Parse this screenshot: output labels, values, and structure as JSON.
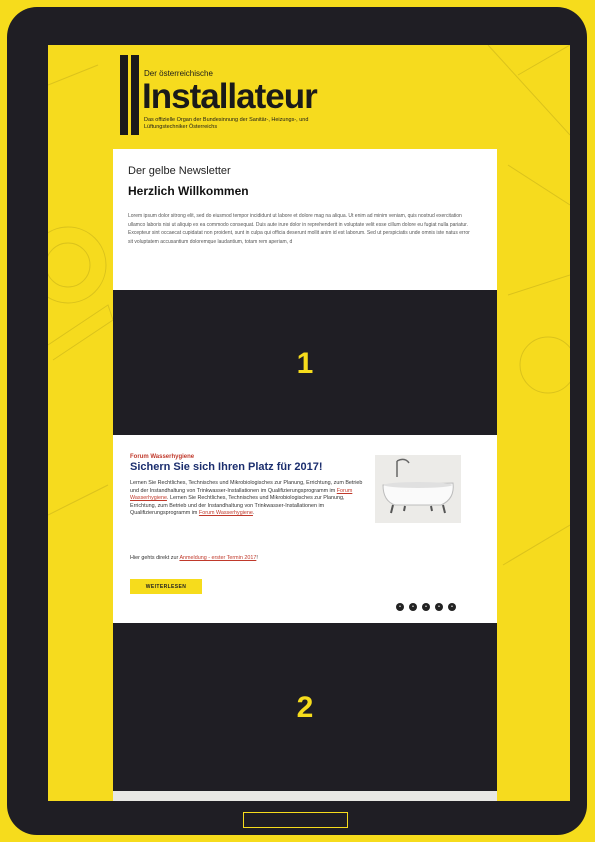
{
  "brand": {
    "kicker": "Der österreichische",
    "name": "Installateur",
    "tagline": "Das offizielle Organ der Bundesinnung der Sanitär-, Heizungs-, und Lüftungstechniker Österreichs"
  },
  "intro": {
    "newsletter_title": "Der gelbe Newsletter",
    "welcome": "Herzlich Willkommen",
    "lorem": "Lorem ipsum dolor sitrong elit, sed do eiusmod tempor incididunt ut labore et dolore mag na aliqua. Ut enim ad minim veniam, quis nostrud exercitation ullamco laboris nisi ut aliquip ex ea commodo consequat. Duis aute irure dolor in reprehenderit in voluptate velit esse cillum dolore eu fugiat nulla pariatur. Excepteur sint occaecat cupidatat non proident, sunt in culpa qui officia deserunt mollit anim id est laborum. Sed ut perspiciatis unde omnis iste natus error sit voluptatem accusantium doloremque laudantium, totam rem aperiam, d"
  },
  "placeholders": {
    "first": "1",
    "second": "2"
  },
  "article": {
    "kicker": "Forum Wasserhygiene",
    "headline": "Sichern Sie sich Ihren Platz für 2017!",
    "body_part1": "Lernen Sie Rechtliches, Technisches und Mikrobiologisches zur Planung, Errichtung, zum Betrieb und der Instandhaltung von Trinkwasser-Installationen im Qualifizierungsprogramm im ",
    "link1": "Forum Wasserhygiene",
    "body_part2": ". Lernen Sie Rechtliches, Technisches und Mikrobiologisches zur Planung, Errichtung, zum Betrieb und der Instandhaltung von Trinkwasser-Installationen im Qualifizierungsprogramm im ",
    "link2": "Forum Wasserhygiene",
    "body_end": ".",
    "cta_prefix": "Hier gehts direkt zur ",
    "cta_link": "Anmeldung - erster Termin 2017",
    "cta_suffix": "!",
    "button": "WEITERLESEN"
  },
  "colors": {
    "brand_yellow": "#f6dc1c",
    "dark": "#1f1e24",
    "headline_blue": "#1b2e6e",
    "link_red": "#c0392b"
  },
  "icons": [
    "tablet-frame",
    "bathtub-image",
    "carousel-dot-icon",
    "home-button"
  ]
}
